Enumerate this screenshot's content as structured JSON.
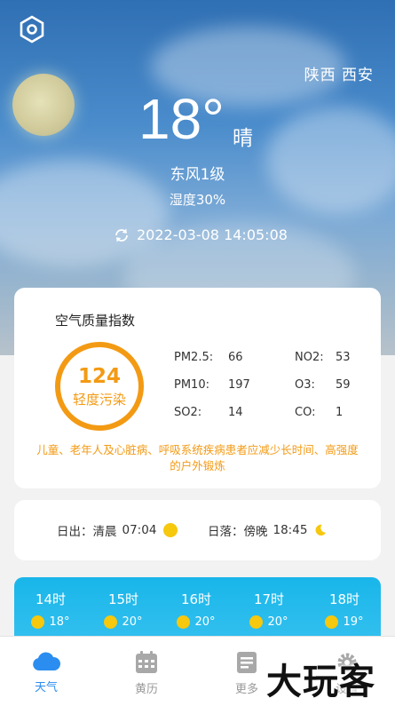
{
  "location": "陕西 西安",
  "current": {
    "temperature": "18°",
    "condition": "晴",
    "wind": "东风1级",
    "humidity": "湿度30%",
    "updated_at": "2022-03-08 14:05:08"
  },
  "aqi": {
    "title": "空气质量指数",
    "value": "124",
    "level": "轻度污染",
    "pollutants": [
      {
        "label": "PM2.5:",
        "value": "66"
      },
      {
        "label": "NO2:",
        "value": "53"
      },
      {
        "label": "PM10:",
        "value": "197"
      },
      {
        "label": "O3:",
        "value": "59"
      },
      {
        "label": "SO2:",
        "value": "14"
      },
      {
        "label": "CO:",
        "value": "1"
      }
    ],
    "advice": "儿童、老年人及心脏病、呼吸系统疾病患者应减少长时间、高强度的户外锻炼",
    "color": "#f39a14"
  },
  "sun": {
    "sunrise_label": "日出：清晨",
    "sunrise_time": "07:04",
    "sunset_label": "日落：傍晚",
    "sunset_time": "18:45"
  },
  "hourly": [
    {
      "hour": "14时",
      "temp": "18°"
    },
    {
      "hour": "15时",
      "temp": "20°"
    },
    {
      "hour": "16时",
      "temp": "20°"
    },
    {
      "hour": "17时",
      "temp": "20°"
    },
    {
      "hour": "18时",
      "temp": "19°"
    }
  ],
  "tabs": [
    {
      "label": "天气",
      "icon": "cloud-icon",
      "active": true
    },
    {
      "label": "黄历",
      "icon": "calendar-icon"
    },
    {
      "label": "更多",
      "icon": "document-icon"
    },
    {
      "label": "设置",
      "icon": "gear-icon"
    }
  ],
  "watermark": "大玩客",
  "colors": {
    "accent": "#2b8df0",
    "hourly_bg": "#19b6ea",
    "sun": "#f6c80e"
  }
}
